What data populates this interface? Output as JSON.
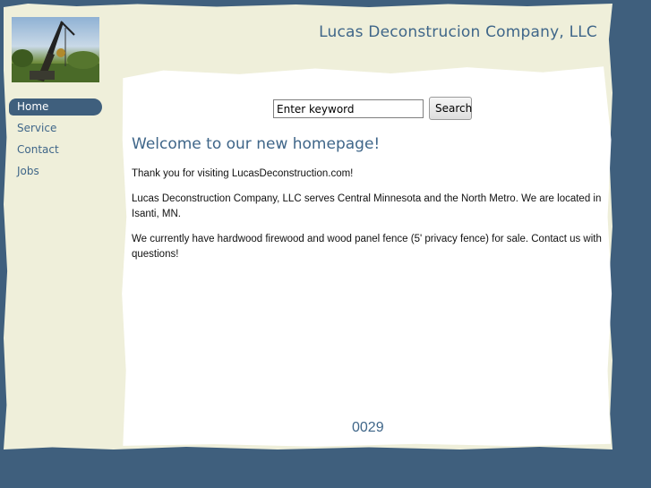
{
  "header": {
    "site_title": "Lucas Deconstrucion Company, LLC",
    "logo_icon": "crane-photo-icon"
  },
  "nav": {
    "items": [
      {
        "label": "Home",
        "active": true
      },
      {
        "label": "Service",
        "active": false
      },
      {
        "label": "Contact",
        "active": false
      },
      {
        "label": "Jobs",
        "active": false
      }
    ]
  },
  "search": {
    "value": "Enter keyword",
    "button_label": "Search"
  },
  "main": {
    "heading": "Welcome to our new homepage!",
    "paragraphs": [
      "Thank you for visiting LucasDeconstruction.com!",
      "Lucas Deconstruction Company, LLC serves Central Minnesota and the North Metro.  We are located in Isanti, MN.",
      "We currently have hardwood firewood and wood panel fence (5' privacy fence) for sale.  Contact us with questions!"
    ]
  },
  "footer": {
    "counter": "0029"
  },
  "colors": {
    "background": "#3f5f7d",
    "paper": "#efefda",
    "accent": "#3f6689"
  }
}
